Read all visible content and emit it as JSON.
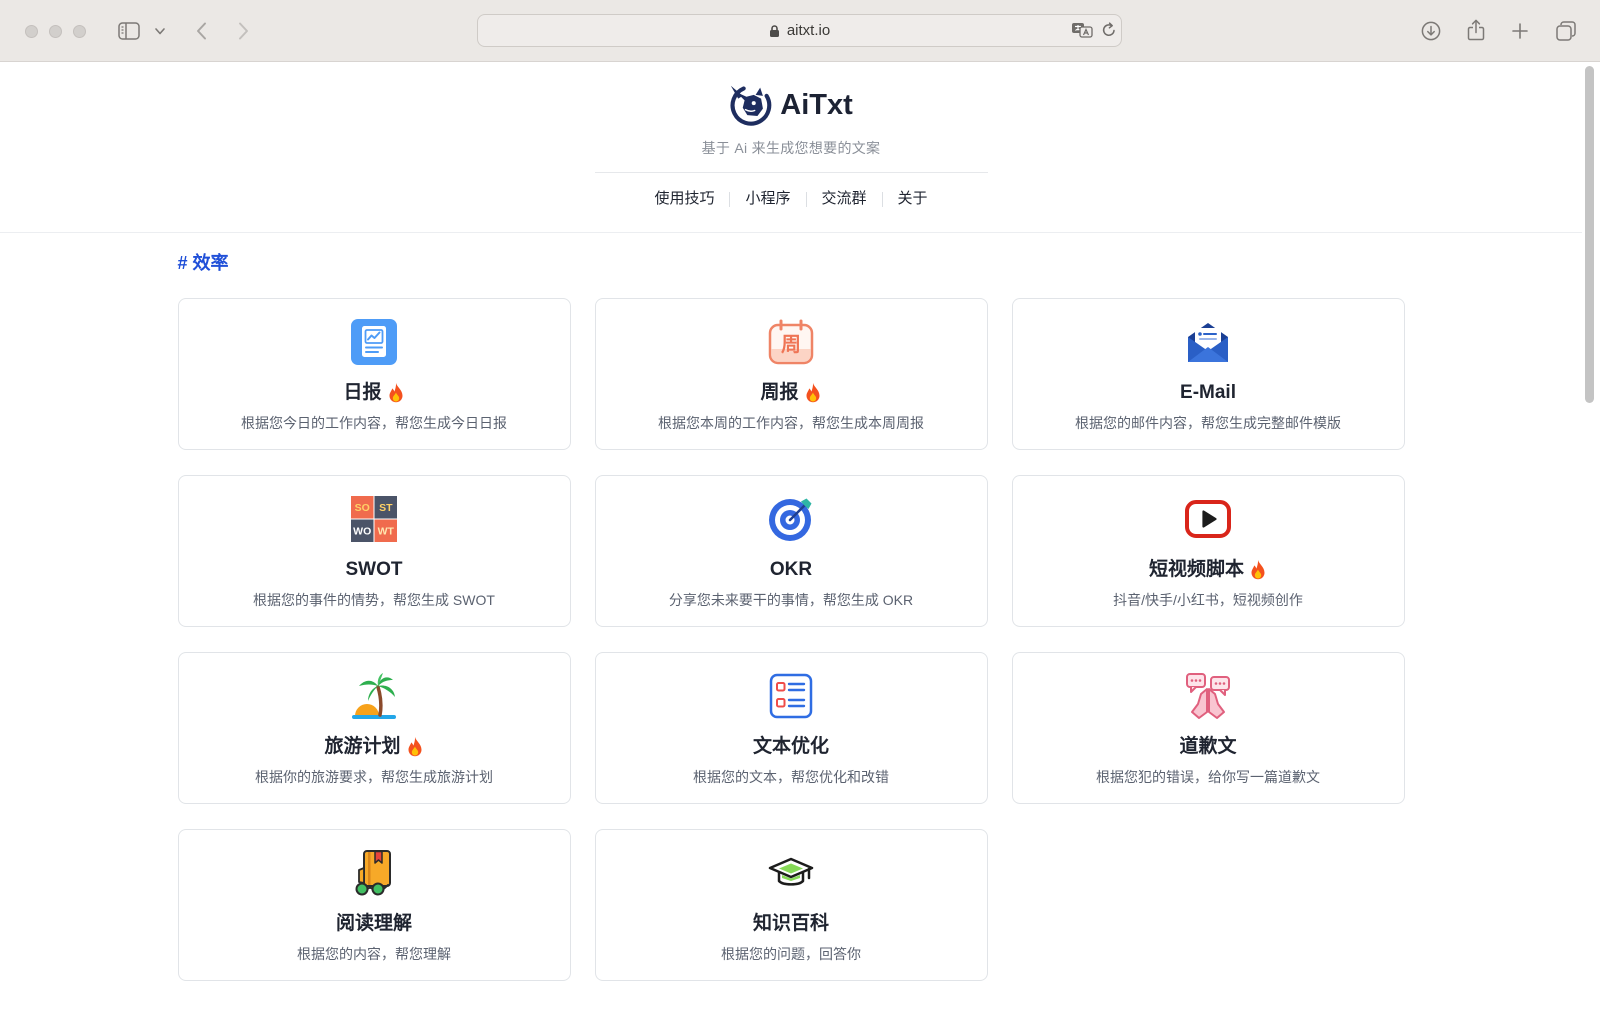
{
  "theme": {
    "accent": "#1f4fd8",
    "brand_navy": "#1e2d5f"
  },
  "browser": {
    "url": "aitxt.io",
    "icons": [
      "sidebar-icon",
      "chevron-down-icon",
      "back-icon",
      "forward-icon",
      "lock-icon",
      "translate-icon",
      "reload-icon",
      "download-icon",
      "share-icon",
      "plus-icon",
      "tabs-overview-icon"
    ]
  },
  "header": {
    "brand": "AiTxt",
    "logo_icon": "rhino-logo-icon",
    "tagline": "基于 Ai 来生成您想要的文案",
    "nav": [
      "使用技巧",
      "小程序",
      "交流群",
      "关于"
    ]
  },
  "section": {
    "title": "# 效率"
  },
  "cards": [
    {
      "title": "日报",
      "desc": "根据您今日的工作内容，帮您生成今日日报",
      "hot": true,
      "icon": "daily-report-icon"
    },
    {
      "title": "周报",
      "desc": "根据您本周的工作内容，帮您生成本周周报",
      "hot": true,
      "icon": "weekly-calendar-icon",
      "icon_text": "周"
    },
    {
      "title": "E-Mail",
      "desc": "根据您的邮件内容，帮您生成完整邮件模版",
      "hot": false,
      "icon": "email-envelope-icon"
    },
    {
      "title": "SWOT",
      "desc": "根据您的事件的情势，帮您生成 SWOT",
      "hot": false,
      "icon": "swot-grid-icon",
      "icon_text": [
        "SO",
        "ST",
        "WO",
        "WT"
      ]
    },
    {
      "title": "OKR",
      "desc": "分享您未来要干的事情，帮您生成 OKR",
      "hot": false,
      "icon": "target-icon"
    },
    {
      "title": "短视频脚本",
      "desc": "抖音/快手/小红书，短视频创作",
      "hot": true,
      "icon": "video-play-icon"
    },
    {
      "title": "旅游计划",
      "desc": "根据你的旅游要求，帮您生成旅游计划",
      "hot": true,
      "icon": "palm-island-icon"
    },
    {
      "title": "文本优化",
      "desc": "根据您的文本，帮您优化和改错",
      "hot": false,
      "icon": "checklist-icon"
    },
    {
      "title": "道歉文",
      "desc": "根据您犯的错误，给你写一篇道歉文",
      "hot": false,
      "icon": "praying-hands-icon"
    },
    {
      "title": "阅读理解",
      "desc": "根据您的内容，帮您理解",
      "hot": false,
      "icon": "book-glasses-icon"
    },
    {
      "title": "知识百科",
      "desc": "根据您的问题，回答你",
      "hot": false,
      "icon": "graduation-cap-icon"
    }
  ]
}
